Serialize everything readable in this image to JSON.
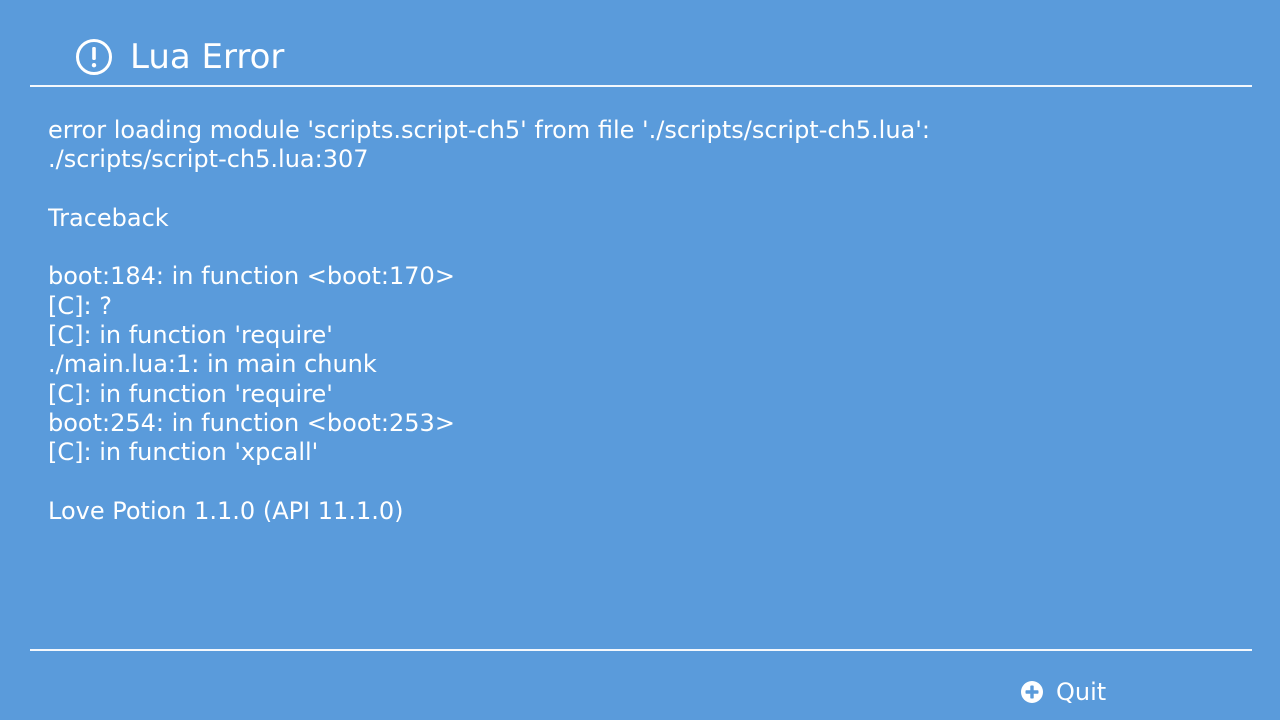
{
  "header": {
    "title": "Lua Error",
    "icon": "exclamation-circle-icon"
  },
  "error": {
    "message_line_1": "error loading module 'scripts.script-ch5' from file './scripts/script-ch5.lua':",
    "message_line_2": "./scripts/script-ch5.lua:307",
    "traceback_heading": "Traceback",
    "traceback_lines": [
      "boot:184: in function <boot:170>",
      "[C]: ?",
      "[C]: in function 'require'",
      "./main.lua:1: in main chunk",
      "[C]: in function 'require'",
      "boot:254: in function <boot:253>",
      "[C]: in function 'xpcall'"
    ],
    "version": "Love Potion 1.1.0 (API 11.1.0)"
  },
  "footer": {
    "quit_label": "Quit",
    "quit_icon": "plus-button-icon"
  },
  "colors": {
    "background": "#5a9bdb",
    "text": "#ffffff",
    "divider": "#f3f8fd"
  }
}
